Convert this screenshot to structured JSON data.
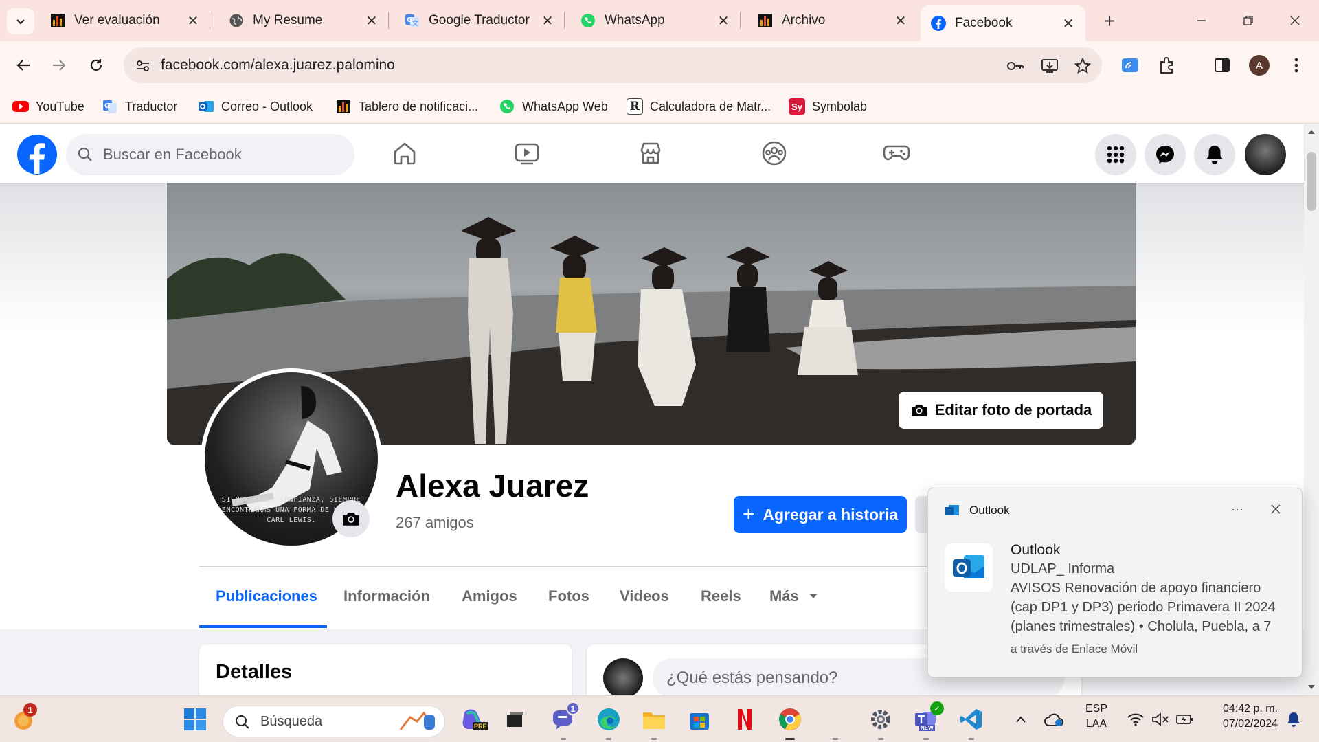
{
  "browser": {
    "tabs": [
      {
        "title": "Ver evaluación",
        "icon": "analytics-icon"
      },
      {
        "title": "My Resume",
        "icon": "globe-icon"
      },
      {
        "title": "Google Traductor",
        "icon": "translate-icon"
      },
      {
        "title": "WhatsApp",
        "icon": "whatsapp-icon"
      },
      {
        "title": "Archivo",
        "icon": "analytics-icon"
      },
      {
        "title": "Facebook",
        "icon": "facebook-icon",
        "active": true
      }
    ],
    "url": "facebook.com/alexa.juarez.palomino",
    "profile_initial": "A",
    "bookmarks": [
      {
        "label": "YouTube",
        "icon": "youtube-icon"
      },
      {
        "label": "Traductor",
        "icon": "translate-icon"
      },
      {
        "label": "Correo - Outlook",
        "icon": "outlook-icon"
      },
      {
        "label": "Tablero de notificaci...",
        "icon": "analytics-icon"
      },
      {
        "label": "WhatsApp Web",
        "icon": "whatsapp-icon"
      },
      {
        "label": "Calculadora de Matr...",
        "icon": "matrix-calculator-icon"
      },
      {
        "label": "Symbolab",
        "icon": "symbolab-icon",
        "icon_text": "Sy"
      }
    ]
  },
  "facebook": {
    "search_placeholder": "Buscar en Facebook",
    "cover_button": "Editar foto de portada",
    "profile_name": "Alexa Juarez",
    "friends": "267 amigos",
    "add_story": "Agregar a historia",
    "avatar_quote": "SI NO TIENES CONFIANZA, SIEMPRE ENCONTRARÁS UNA FORMA DE N... -CARL LEWIS.",
    "tabs": [
      "Publicaciones",
      "Información",
      "Amigos",
      "Fotos",
      "Videos",
      "Reels",
      "Más"
    ],
    "active_tab": "Publicaciones",
    "details_title": "Detalles",
    "post_placeholder": "¿Qué estás pensando?",
    "brand_color": "#0866ff"
  },
  "notification": {
    "app": "Outlook",
    "title": "Outlook",
    "lines": [
      "UDLAP_ Informa",
      "AVISOS Renovación de apoyo financiero",
      "(cap DP1 y DP3) periodo Primavera II 2024",
      "(planes trimestrales) • Cholula, Puebla, a 7"
    ],
    "footer": "a través de Enlace Móvil",
    "more": "···"
  },
  "taskbar": {
    "search_placeholder": "Búsqueda",
    "language": "ESP",
    "layout": "LAA",
    "time": "04:42 p. m.",
    "date": "07/02/2024",
    "weather_badge": "1",
    "chat_badge": "1",
    "teams_label": "NEW",
    "copilot_label": "PRE"
  }
}
